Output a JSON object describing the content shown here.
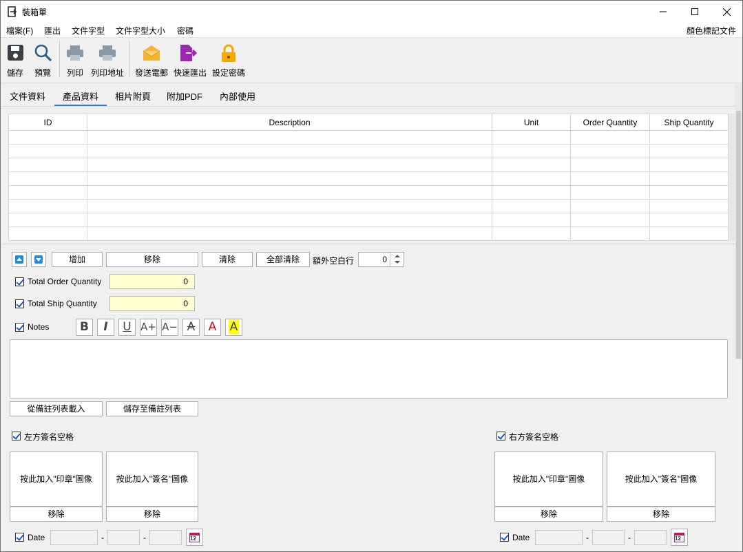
{
  "window": {
    "title": "裝箱單",
    "controls": {
      "minimize": "—",
      "maximize": "☐",
      "close": "✕"
    }
  },
  "menu": {
    "items": [
      "檔案(F)",
      "匯出",
      "文件字型",
      "文件字型大小",
      "密碼"
    ],
    "right": "顏色標記文件"
  },
  "toolbar": {
    "save": "儲存",
    "preview": "預覽",
    "print": "列印",
    "print_address": "列印地址",
    "send_email": "發送電郵",
    "quick_export": "快速匯出",
    "set_password": "設定密碼"
  },
  "tabs": [
    "文件資料",
    "產品資料",
    "相片附頁",
    "附加PDF",
    "內部使用"
  ],
  "grid": {
    "columns": [
      "ID",
      "Description",
      "Unit",
      "Order Quantity",
      "Ship Quantity"
    ],
    "empty_rows": 8
  },
  "row_controls": {
    "add": "增加",
    "remove": "移除",
    "clear": "清除",
    "clear_all": "全部清除",
    "extra_blank_rows_label": "額外空白行",
    "extra_blank_rows_value": "0"
  },
  "totals": {
    "total_order_label": "Total Order Quantity",
    "total_order_value": "0",
    "total_ship_label": "Total Ship Quantity",
    "total_ship_value": "0"
  },
  "notes": {
    "label": "Notes",
    "format_buttons": [
      "B",
      "I",
      "U",
      "A+",
      "A−",
      "A",
      "A",
      "A"
    ],
    "load_button": "從備註列表載入",
    "save_button": "儲存至備註列表"
  },
  "left_signature": {
    "label": "左方簽名空格",
    "stamp_button": "按此加入\"印章\"圖像",
    "sign_button": "按此加入\"簽名\"圖像",
    "remove": "移除",
    "remove2": "移除",
    "date_label": "Date",
    "dash": "-"
  },
  "right_signature": {
    "label": "右方簽名空格",
    "stamp_button": "按此加入\"印章\"圖像",
    "sign_button": "按此加入\"簽名\"圖像",
    "remove": "移除",
    "remove2": "移除",
    "date_label": "Date",
    "dash": "-"
  },
  "calendar_icon_text": "12",
  "colors": {
    "accent": "#2d7cd6",
    "highlight_field": "#ffffd0",
    "email_icon": "#f5b335",
    "export_icon": "#9c27b0",
    "lock_icon": "#f2a900",
    "calendar": "#c2185b"
  }
}
